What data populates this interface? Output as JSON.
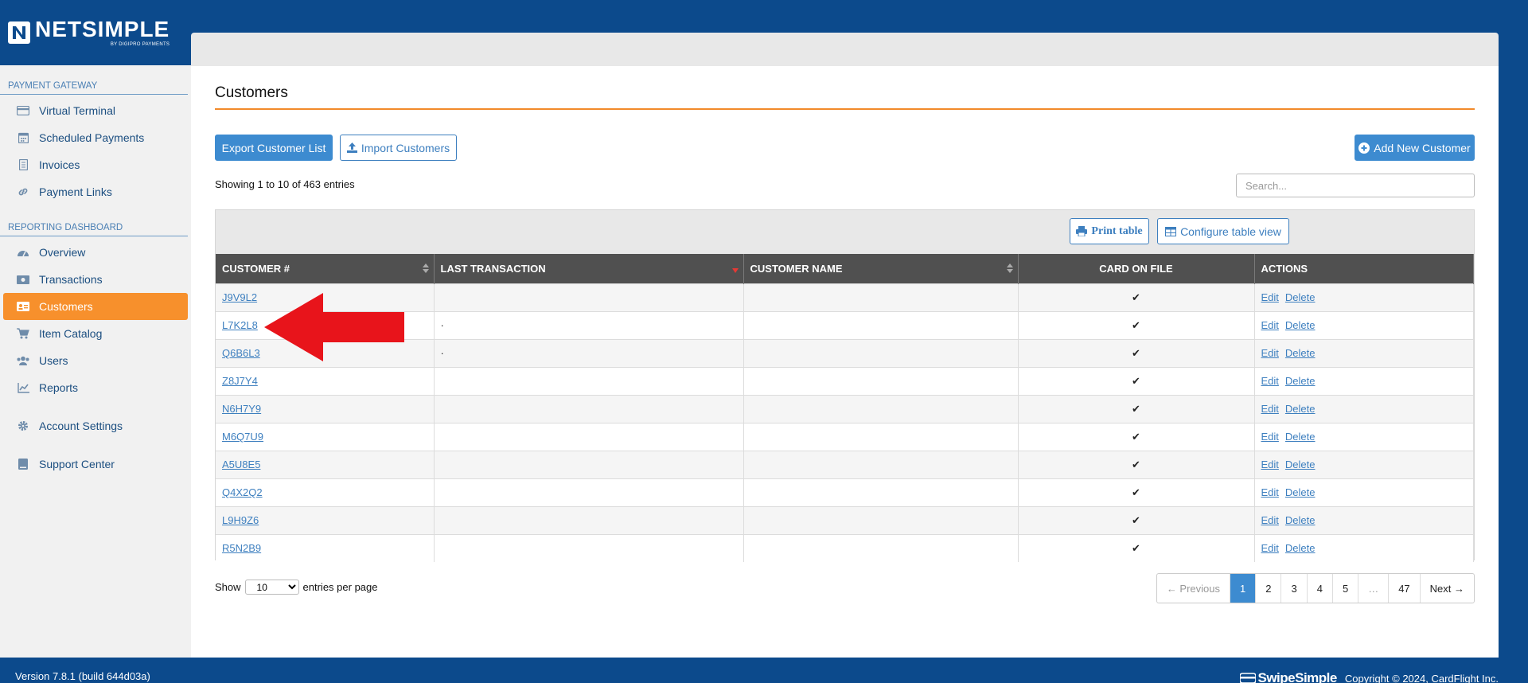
{
  "brand": {
    "logo_text": "NETSIMPLE",
    "logo_sub": "BY DIGIPRO PAYMENTS"
  },
  "sidebar": {
    "section_gateway": "PAYMENT GATEWAY",
    "gateway_items": [
      {
        "label": "Virtual Terminal",
        "icon": "credit-card-icon"
      },
      {
        "label": "Scheduled Payments",
        "icon": "calendar-icon"
      },
      {
        "label": "Invoices",
        "icon": "invoice-icon"
      },
      {
        "label": "Payment Links",
        "icon": "link-icon"
      }
    ],
    "section_reporting": "REPORTING DASHBOARD",
    "reporting_items": [
      {
        "label": "Overview",
        "icon": "gauge-icon"
      },
      {
        "label": "Transactions",
        "icon": "money-icon"
      },
      {
        "label": "Customers",
        "icon": "id-card-icon",
        "active": true
      },
      {
        "label": "Item Catalog",
        "icon": "cart-icon"
      },
      {
        "label": "Users",
        "icon": "users-icon"
      },
      {
        "label": "Reports",
        "icon": "chart-icon"
      }
    ],
    "account_settings": "Account Settings",
    "support_center": "Support Center"
  },
  "page": {
    "title": "Customers",
    "export_button": "Export Customer List",
    "import_button": "Import Customers",
    "add_button": "Add New Customer",
    "showing": "Showing 1 to 10 of 463 entries",
    "search_placeholder": "Search...",
    "print_button": "Print table",
    "configure_button": "Configure table view"
  },
  "table": {
    "columns": [
      "CUSTOMER #",
      "LAST TRANSACTION",
      "CUSTOMER NAME",
      "CARD ON FILE",
      "ACTIONS"
    ],
    "rows": [
      {
        "id": "J9V9L2",
        "last": "",
        "name": "",
        "card": "✔"
      },
      {
        "id": "L7K2L8",
        "last": "·",
        "name": "",
        "card": "✔"
      },
      {
        "id": "Q6B6L3",
        "last": "·",
        "name": "",
        "card": "✔"
      },
      {
        "id": "Z8J7Y4",
        "last": "",
        "name": "",
        "card": "✔"
      },
      {
        "id": "N6H7Y9",
        "last": "",
        "name": "",
        "card": "✔"
      },
      {
        "id": "M6Q7U9",
        "last": "",
        "name": "",
        "card": "✔"
      },
      {
        "id": "A5U8E5",
        "last": "",
        "name": "",
        "card": "✔"
      },
      {
        "id": "Q4X2Q2",
        "last": "",
        "name": "",
        "card": "✔"
      },
      {
        "id": "L9H9Z6",
        "last": "",
        "name": "",
        "card": "✔"
      },
      {
        "id": "R5N2B9",
        "last": "",
        "name": "",
        "card": "✔"
      }
    ],
    "edit_label": "Edit",
    "delete_label": "Delete"
  },
  "per_page": {
    "show": "Show",
    "value": "10",
    "suffix": "entries per page"
  },
  "pagination": {
    "prev": "← Previous",
    "pages": [
      "1",
      "2",
      "3",
      "4",
      "5",
      "…",
      "47"
    ],
    "next": "Next →",
    "active": "1"
  },
  "footer": {
    "version": "Version 7.8.1 (build 644d03a)",
    "swipe": "SwipeSimple",
    "copyright": "Copyright © 2024, CardFlight Inc."
  },
  "colors": {
    "brand_blue": "#0c4a8c",
    "accent_orange": "#f7902c",
    "button_blue": "#3d8bd0",
    "arrow_red": "#e8141b"
  }
}
